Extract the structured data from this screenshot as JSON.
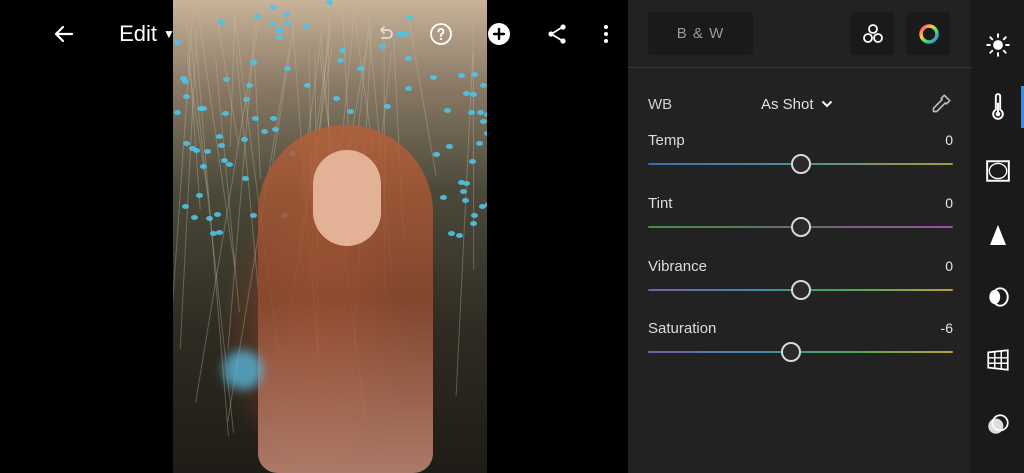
{
  "toolbar": {
    "edit_label": "Edit",
    "icons": [
      "back-arrow-icon",
      "undo-icon",
      "help-icon",
      "add-icon",
      "share-icon",
      "more-vertical-icon"
    ]
  },
  "panel": {
    "bw_label": "B & W",
    "wb": {
      "label": "WB",
      "value": "As Shot"
    },
    "sliders": [
      {
        "name": "Temp",
        "value": "0",
        "position": 0.5
      },
      {
        "name": "Tint",
        "value": "0",
        "position": 0.5
      },
      {
        "name": "Vibrance",
        "value": "0",
        "position": 0.5
      },
      {
        "name": "Saturation",
        "value": "-6",
        "position": 0.47
      }
    ]
  },
  "tools": [
    "light-icon",
    "color-thermometer-icon",
    "effects-vignette-icon",
    "detail-icon",
    "optics-icon",
    "geometry-icon",
    "presets-icon"
  ],
  "colors": {
    "accent": "#2d8ff0",
    "panel_bg": "#222222",
    "strip_bg": "#1a1a1a"
  }
}
